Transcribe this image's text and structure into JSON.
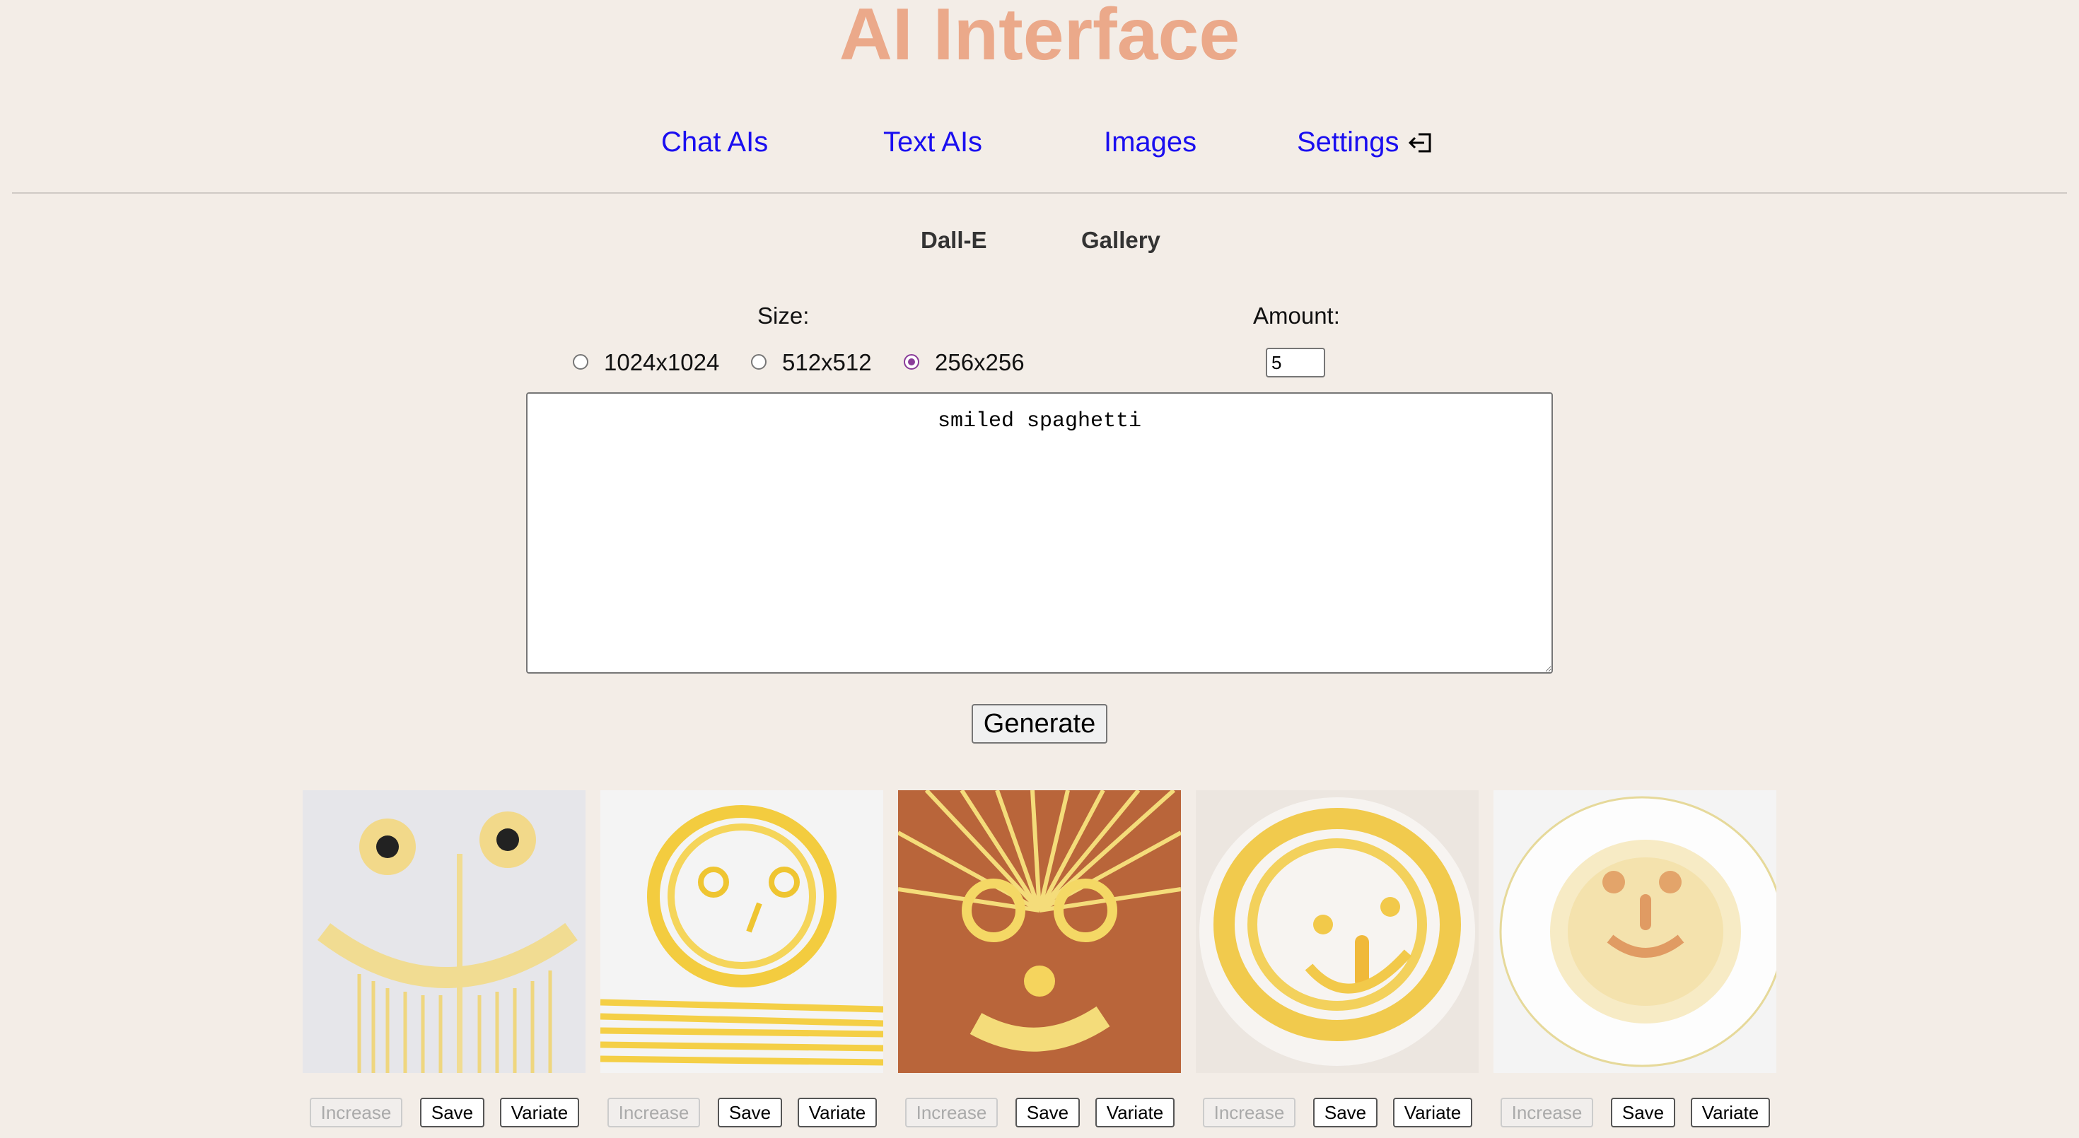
{
  "app": {
    "title": "AI Interface"
  },
  "nav": {
    "items": [
      {
        "label": "Chat AIs"
      },
      {
        "label": "Text AIs"
      },
      {
        "label": "Images"
      },
      {
        "label": "Settings"
      }
    ],
    "logout_icon": "logout-icon"
  },
  "subtabs": [
    {
      "label": "Dall-E"
    },
    {
      "label": "Gallery"
    }
  ],
  "size": {
    "label": "Size:",
    "options": [
      {
        "label": "1024x1024",
        "checked": false
      },
      {
        "label": "512x512",
        "checked": false
      },
      {
        "label": "256x256",
        "checked": true
      }
    ]
  },
  "amount": {
    "label": "Amount:",
    "value": "5"
  },
  "prompt": {
    "value": "smiled spaghetti"
  },
  "generate": {
    "label": "Generate"
  },
  "results": {
    "actions": {
      "increase": "Increase",
      "save": "Save",
      "variate": "Variate"
    },
    "images": [
      {
        "description": "spaghetti-face-1"
      },
      {
        "description": "spaghetti-face-2"
      },
      {
        "description": "spaghetti-face-3"
      },
      {
        "description": "spaghetti-face-4"
      },
      {
        "description": "spaghetti-face-5"
      }
    ]
  },
  "colors": {
    "title": "#eba98a",
    "link": "#1a0ef0",
    "background": "#f3ede7",
    "radio_accent": "#8a3c99"
  }
}
